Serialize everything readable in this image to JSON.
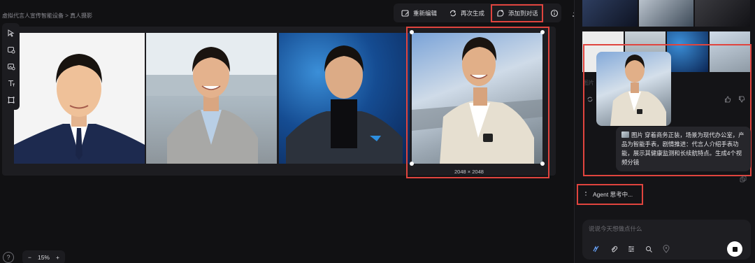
{
  "breadcrumb": "虚拟代言人宣传智能设备 > 真人摄影",
  "toolbar": {
    "re_edit": "重新编辑",
    "regenerate": "再次生成",
    "add_to_chat": "添加到对话"
  },
  "canvas": {
    "selected_size": "2048 × 2048"
  },
  "zoom": {
    "level": "15%",
    "minus": "−",
    "plus": "+"
  },
  "chat": {
    "faded_prefix": "图片",
    "user_message_label": "图片",
    "user_message": "穿着商务正装，场景为现代办公室，产品为智能手表，剧情推进：代言人介绍手表功能，展示其健康监测和长续航特点。生成4个视频分镜",
    "agent_status": "Agent 思考中..."
  },
  "composer": {
    "placeholder": "说说今天想做点什么"
  },
  "colors": {
    "highlight": "#e0443e",
    "background": "#111113",
    "panel": "#1c1c20"
  },
  "icons": [
    "edit-icon",
    "refresh-icon",
    "add-chat-icon",
    "info-icon",
    "download-icon",
    "cursor-icon",
    "lasso-icon",
    "image-gen-icon",
    "text-icon",
    "crop-icon",
    "help-icon",
    "stop-icon"
  ]
}
